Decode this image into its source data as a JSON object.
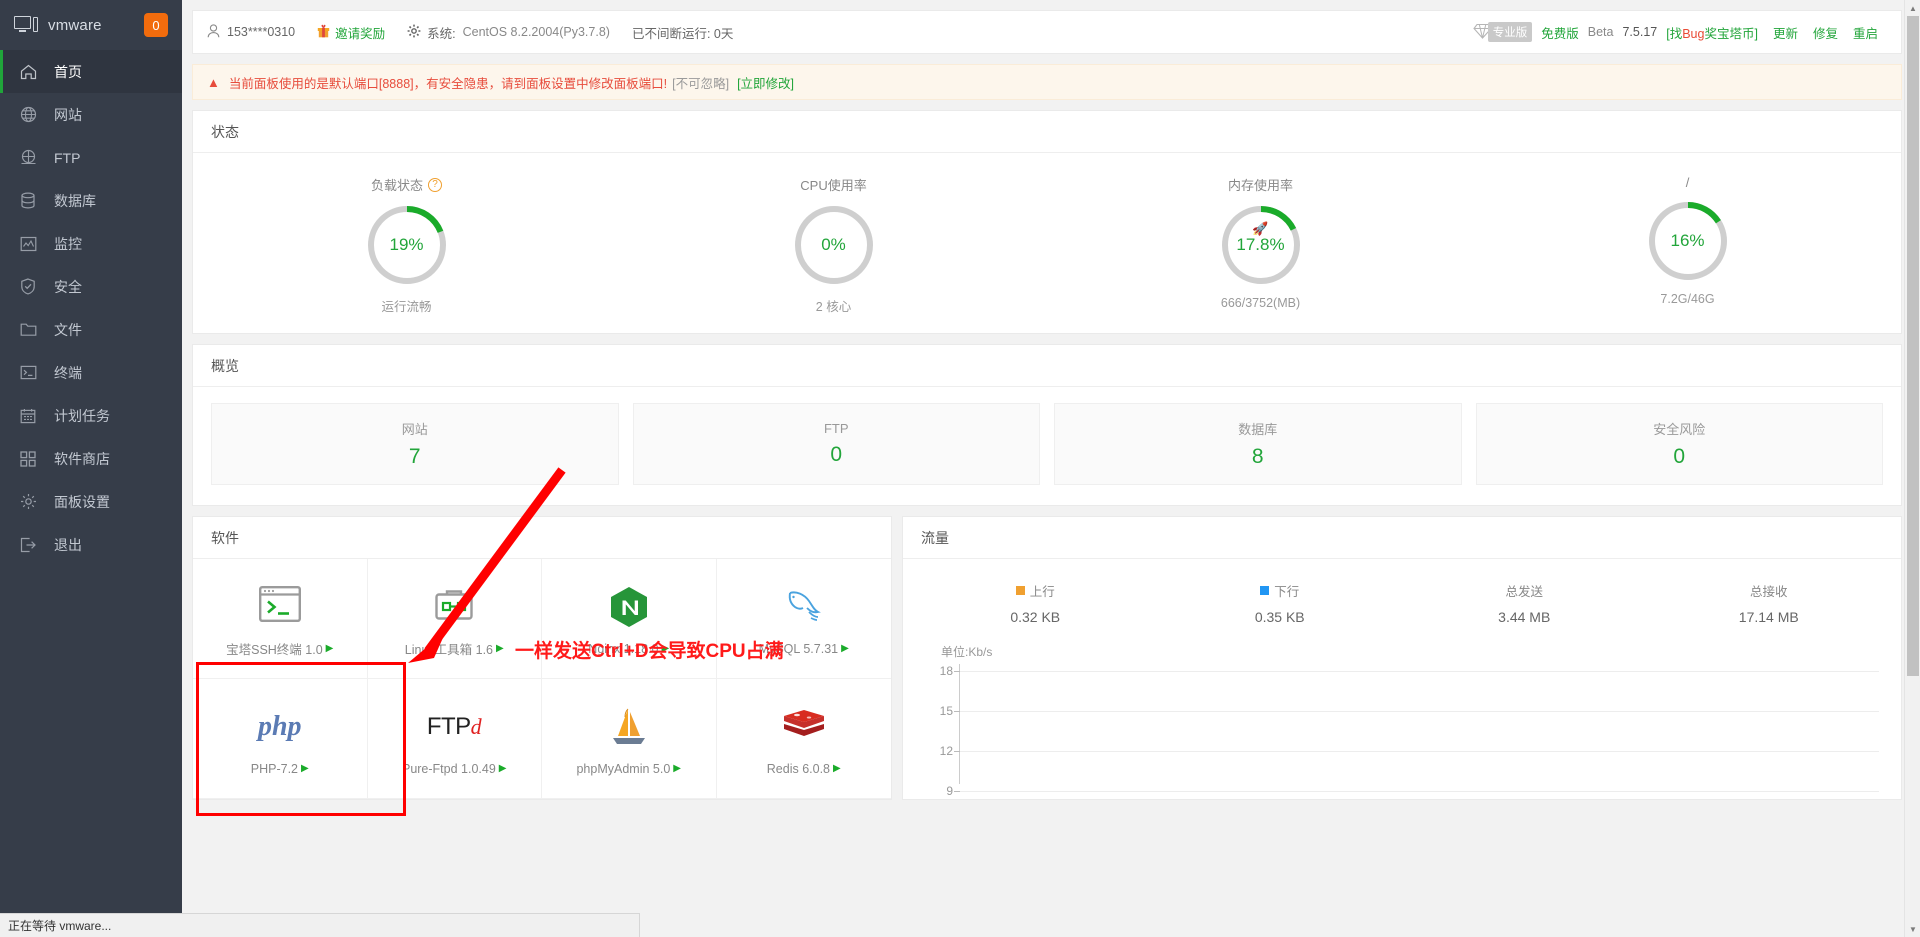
{
  "sidebar": {
    "brand": {
      "name": "vmware",
      "badge": "0",
      "icon": "monitor-icon"
    },
    "items": [
      {
        "label": "首页",
        "icon": "home-icon",
        "active": true
      },
      {
        "label": "网站",
        "icon": "globe-icon",
        "active": false
      },
      {
        "label": "FTP",
        "icon": "ftp-icon",
        "active": false
      },
      {
        "label": "数据库",
        "icon": "database-icon",
        "active": false
      },
      {
        "label": "监控",
        "icon": "monitor-chart-icon",
        "active": false
      },
      {
        "label": "安全",
        "icon": "shield-check-icon",
        "active": false
      },
      {
        "label": "文件",
        "icon": "folder-icon",
        "active": false
      },
      {
        "label": "终端",
        "icon": "terminal-icon",
        "active": false
      },
      {
        "label": "计划任务",
        "icon": "calendar-icon",
        "active": false
      },
      {
        "label": "软件商店",
        "icon": "grid-apps-icon",
        "active": false
      },
      {
        "label": "面板设置",
        "icon": "gear-icon",
        "active": false
      },
      {
        "label": "退出",
        "icon": "logout-icon",
        "active": false
      }
    ]
  },
  "topbar": {
    "account": "153****0310",
    "invite": "邀请奖励",
    "system_label": "系统:",
    "system_value": "CentOS 8.2.2004(Py3.7.8)",
    "uptime": "已不间断运行: 0天",
    "pro_tag": "专业版",
    "free": "免费版",
    "beta": "Beta",
    "version": "7.5.17",
    "bug_prefix": "[找",
    "bug_word": "Bug",
    "bug_suffix": "奖宝塔币]",
    "update": "更新",
    "repair": "修复",
    "restart": "重启"
  },
  "warning": {
    "icon": "warning-triangle-icon",
    "message": "当前面板使用的是默认端口[8888]，有安全隐患，请到面板设置中修改面板端口!",
    "note": "[不可忽略]",
    "link": "[立即修改]"
  },
  "status": {
    "title": "状态",
    "gauges": [
      {
        "title": "负载状态",
        "has_help": true,
        "value": "19%",
        "percent": 19,
        "sub": "运行流畅",
        "rocket": false
      },
      {
        "title": "CPU使用率",
        "has_help": false,
        "value": "0%",
        "percent": 0,
        "sub": "2 核心",
        "rocket": false
      },
      {
        "title": "内存使用率",
        "has_help": false,
        "value": "17.8%",
        "percent": 17.8,
        "sub": "666/3752(MB)",
        "rocket": true
      },
      {
        "title": "/",
        "has_help": false,
        "value": "16%",
        "percent": 16,
        "sub": "7.2G/46G",
        "rocket": false
      }
    ]
  },
  "overview": {
    "title": "概览",
    "cards": [
      {
        "label": "网站",
        "value": "7"
      },
      {
        "label": "FTP",
        "value": "0"
      },
      {
        "label": "数据库",
        "value": "8"
      },
      {
        "label": "安全风险",
        "value": "0"
      }
    ]
  },
  "software": {
    "title": "软件",
    "items": [
      {
        "name": "宝塔SSH终端 1.0",
        "icon": "terminal-window-icon",
        "highlighted": true
      },
      {
        "name": "Linux工具箱 1.6",
        "icon": "toolbox-icon",
        "highlighted": false
      },
      {
        "name": "Nginx 1.18.0",
        "icon": "nginx-icon",
        "highlighted": false
      },
      {
        "name": "MySQL 5.7.31",
        "icon": "mysql-dolphin-icon",
        "highlighted": false
      },
      {
        "name": "PHP-7.2",
        "icon": "php-icon",
        "highlighted": false
      },
      {
        "name": "Pure-Ftpd 1.0.49",
        "icon": "pureftpd-icon",
        "highlighted": false
      },
      {
        "name": "phpMyAdmin 5.0",
        "icon": "phpmyadmin-sailboat-icon",
        "highlighted": false
      },
      {
        "name": "Redis 6.0.8",
        "icon": "redis-icon",
        "highlighted": false
      }
    ]
  },
  "flow": {
    "title": "流量",
    "stats": [
      {
        "label": "上行",
        "value": "0.32 KB",
        "swatch": "#f0a030"
      },
      {
        "label": "下行",
        "value": "0.35 KB",
        "swatch": "#2196f3"
      },
      {
        "label": "总发送",
        "value": "3.44 MB",
        "swatch": ""
      },
      {
        "label": "总接收",
        "value": "17.14 MB",
        "swatch": ""
      }
    ]
  },
  "chart_data": {
    "type": "line",
    "title": "流量",
    "unit_label": "单位:Kb/s",
    "ylabel": "Kb/s",
    "xlabel": "",
    "yticks": [
      "18",
      "15",
      "12",
      "9"
    ],
    "ylim": [
      9,
      18
    ],
    "grid": true,
    "series": [
      {
        "name": "上行",
        "color": "#f0a030",
        "values": []
      },
      {
        "name": "下行",
        "color": "#2196f3",
        "values": []
      }
    ],
    "x": [],
    "legend_position": "top"
  },
  "annotations": {
    "note_text": "一样发送Ctrl+D会导致CPU占满",
    "color": "#ff1a1a"
  },
  "statusbar": {
    "text": "正在等待 vmware..."
  },
  "colors": {
    "accent_green": "#22a53a",
    "sidebar_bg": "#363d49",
    "warning_bg": "#fdf6ec",
    "annotation_red": "#ff0000"
  }
}
